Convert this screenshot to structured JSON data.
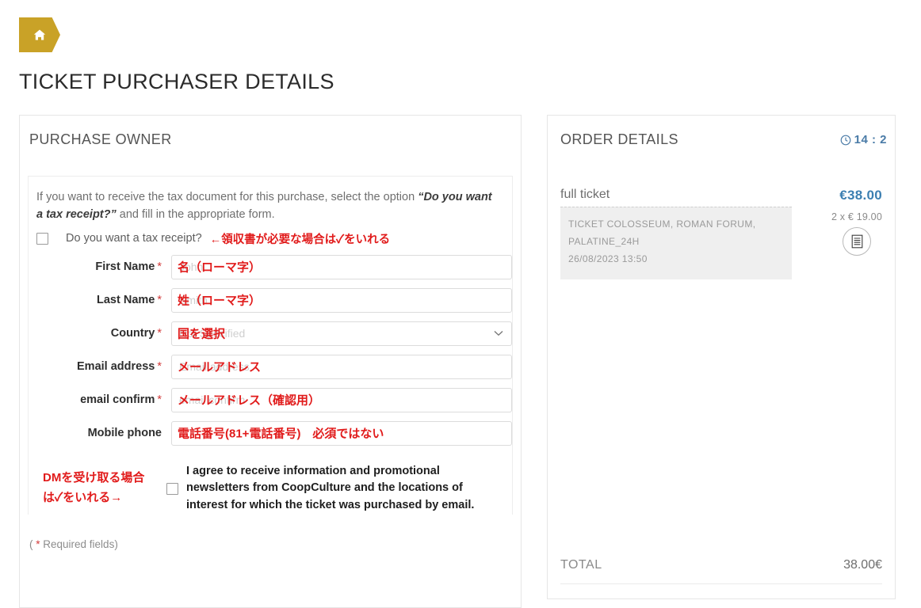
{
  "header": {
    "home_icon": "home-icon",
    "title": "TICKET PURCHASER DETAILS"
  },
  "purchase_owner": {
    "heading": "PURCHASE OWNER",
    "intro_part1": "If you want to receive the tax document for this purchase, select the option ",
    "intro_bold": "“Do you want a tax receipt?”",
    "intro_part2": " and fill in the appropriate form.",
    "tax_receipt_label": "Do you want a tax receipt?",
    "tax_receipt_annotation": "←領収書が必要な場合は✓をいれる",
    "fields": [
      {
        "label": "First Name",
        "required": true,
        "placeholder": "John",
        "annotation": "名（ローマ字）",
        "type": "text"
      },
      {
        "label": "Last Name",
        "required": true,
        "placeholder": "Smith",
        "annotation": "姓（ローマ字）",
        "type": "text"
      },
      {
        "label": "Country",
        "required": true,
        "placeholder": "Not Specified",
        "annotation": "国を選択",
        "type": "select"
      },
      {
        "label": "Email address",
        "required": true,
        "placeholder": "Email address",
        "annotation": "メールアドレス",
        "type": "email"
      },
      {
        "label": "email confirm",
        "required": true,
        "placeholder": "email confirm",
        "annotation": "メールアドレス（確認用）",
        "type": "email"
      },
      {
        "label": "Mobile phone",
        "required": false,
        "placeholder": "",
        "annotation": "電話番号(81+電話番号)　必須ではない",
        "type": "tel"
      }
    ],
    "newsletter_annotation_line1": "DMを受け取る場合",
    "newsletter_annotation_line2": "は✓をいれる→",
    "newsletter_text": "I agree to receive information and promotional newsletters from CoopCulture and the locations of interest for which the ticket was purchased by email.",
    "required_note_open": "( ",
    "required_note_star": "*",
    "required_note_text": " Required fields)"
  },
  "order_details": {
    "heading": "ORDER DETAILS",
    "timer": "14 : 2",
    "item": {
      "name": "full ticket",
      "price": "€38.00",
      "quantity_line": "2 x € 19.00",
      "meta_line1": "TICKET COLOSSEUM, ROMAN FORUM,",
      "meta_line2": "PALATINE_24H",
      "meta_line3": "26/08/2023 13:50",
      "doc_icon": "document-icon"
    },
    "total_label": "TOTAL",
    "total_value": "38.00€"
  },
  "colors": {
    "brand_gold": "#c9a227",
    "accent_blue": "#3c7fb1",
    "annotation_red": "#e11b1b",
    "required_red": "#d23b3b"
  }
}
